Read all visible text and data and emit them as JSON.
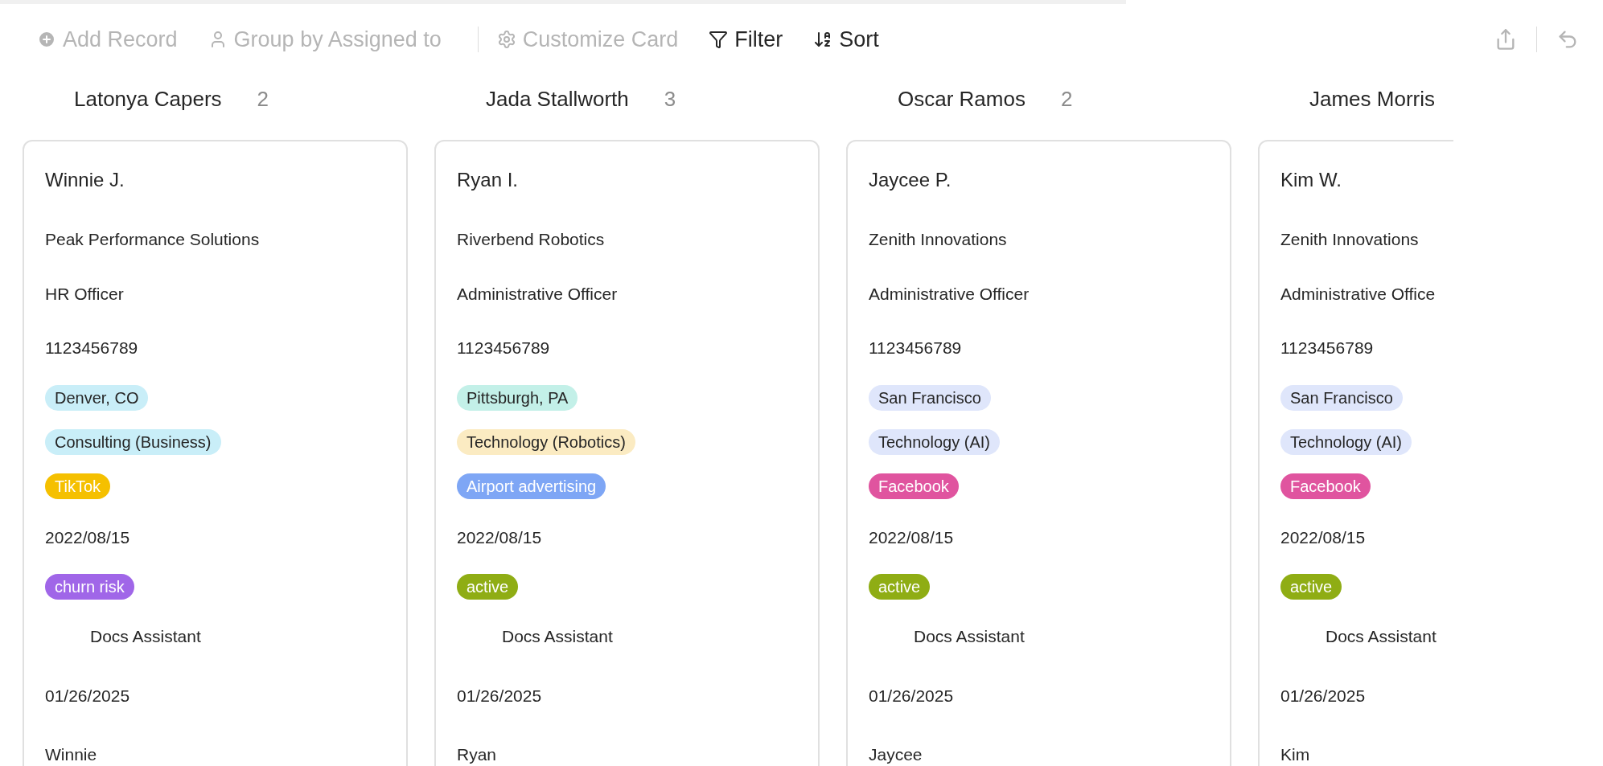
{
  "toolbar": {
    "items": [
      {
        "kind": "add",
        "label": "Add Record",
        "disabled": true
      },
      {
        "kind": "group",
        "label": "Group by Assigned to",
        "disabled": true
      },
      {
        "kind": "customize",
        "label": "Customize Card",
        "disabled": true
      },
      {
        "kind": "filter",
        "label": "Filter",
        "disabled": false
      },
      {
        "kind": "sort",
        "label": "Sort",
        "disabled": false
      }
    ]
  },
  "columns": [
    {
      "name": "Latonya Capers",
      "count": "2",
      "cards": [
        {
          "name": "Winnie J.",
          "company": "Peak Performance Solutions",
          "title": "HR Officer",
          "phone": "1123456789",
          "tags": [
            {
              "label": "Denver, CO",
              "color": "#c9eef8"
            },
            {
              "label": "Consulting (Business)",
              "color": "#c9eef8"
            },
            {
              "label": "TikTok",
              "color": "#f5c000"
            }
          ],
          "date": "2022/08/15",
          "status": {
            "label": "churn risk",
            "color": "#a066e8"
          },
          "assistant": "Docs Assistant",
          "created": "01/26/2025",
          "first_name": "Winnie"
        }
      ]
    },
    {
      "name": "Jada Stallworth",
      "count": "3",
      "cards": [
        {
          "name": "Ryan I.",
          "company": "Riverbend Robotics",
          "title": "Administrative Officer",
          "phone": "1123456789",
          "tags": [
            {
              "label": "Pittsburgh, PA",
              "color": "#c3f0e8"
            },
            {
              "label": "Technology (Robotics)",
              "color": "#fbebc2"
            },
            {
              "label": "Airport advertising",
              "color": "#7ea6f5"
            }
          ],
          "date": "2022/08/15",
          "status": {
            "label": "active",
            "color": "#8fad14"
          },
          "assistant": "Docs Assistant",
          "created": "01/26/2025",
          "first_name": "Ryan"
        }
      ]
    },
    {
      "name": "Oscar Ramos",
      "count": "2",
      "cards": [
        {
          "name": "Jaycee P.",
          "company": "Zenith Innovations",
          "title": "Administrative Officer",
          "phone": "1123456789",
          "tags": [
            {
              "label": "San Francisco",
              "color": "#dfe6fb"
            },
            {
              "label": "Technology (AI)",
              "color": "#dfe6fb"
            },
            {
              "label": "Facebook",
              "color": "#e0549f"
            }
          ],
          "date": "2022/08/15",
          "status": {
            "label": "active",
            "color": "#8fad14"
          },
          "assistant": "Docs Assistant",
          "created": "01/26/2025",
          "first_name": "Jaycee"
        }
      ]
    },
    {
      "name": "James Morris",
      "cards": [
        {
          "name": "Kim W.",
          "company": "Zenith Innovations",
          "title": "Administrative Office",
          "phone": "1123456789",
          "tags": [
            {
              "label": "San Francisco",
              "color": "#dfe6fb"
            },
            {
              "label": "Technology (AI)",
              "color": "#dfe6fb"
            },
            {
              "label": "Facebook",
              "color": "#e0549f"
            }
          ],
          "date": "2022/08/15",
          "status": {
            "label": "active",
            "color": "#8fad14"
          },
          "assistant": "Docs Assistant",
          "created": "01/26/2025",
          "first_name": "Kim"
        }
      ]
    }
  ]
}
